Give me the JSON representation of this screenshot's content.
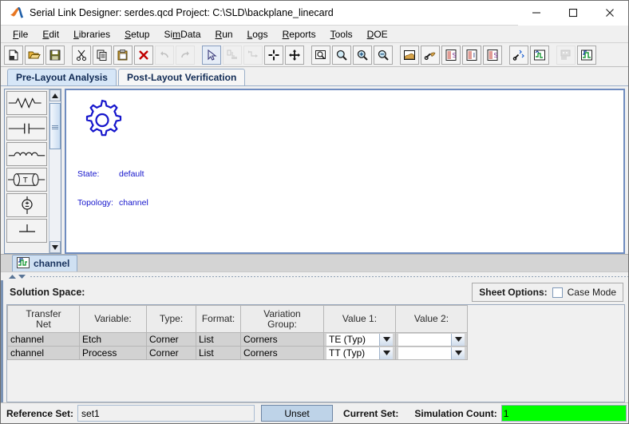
{
  "window": {
    "title": "Serial Link Designer: serdes.qcd Project: C:\\SLD\\backplane_linecard",
    "logo_icon": "matlab-membrane-icon",
    "minimize_label": "minimize-icon",
    "maximize_label": "maximize-icon",
    "close_label": "close-icon"
  },
  "menu": {
    "items": [
      {
        "label": "File",
        "mnemonic": "F"
      },
      {
        "label": "Edit",
        "mnemonic": "E"
      },
      {
        "label": "Libraries",
        "mnemonic": "L"
      },
      {
        "label": "Setup",
        "mnemonic": "S"
      },
      {
        "label": "SimData",
        "mnemonic": "m"
      },
      {
        "label": "Run",
        "mnemonic": "R"
      },
      {
        "label": "Logs",
        "mnemonic": "L"
      },
      {
        "label": "Reports",
        "mnemonic": "R"
      },
      {
        "label": "Tools",
        "mnemonic": "T"
      },
      {
        "label": "DOE",
        "mnemonic": "D"
      }
    ]
  },
  "toolbar": {
    "buttons": [
      {
        "name": "new-icon",
        "enabled": true
      },
      {
        "name": "open-folder-icon",
        "enabled": true
      },
      {
        "name": "save-disk-icon",
        "enabled": true
      },
      {
        "name": "cut-scissors-icon",
        "enabled": true
      },
      {
        "name": "copy-icon",
        "enabled": true
      },
      {
        "name": "paste-clipboard-icon",
        "enabled": true
      },
      {
        "name": "delete-x-icon",
        "enabled": true
      },
      {
        "name": "undo-icon",
        "enabled": false
      },
      {
        "name": "redo-icon",
        "enabled": false
      },
      {
        "name": "select-arrow-icon",
        "enabled": true
      },
      {
        "name": "place-part-icon",
        "enabled": false
      },
      {
        "name": "route-icon",
        "enabled": false
      },
      {
        "name": "crosshair-icon",
        "enabled": true
      },
      {
        "name": "pan-move-icon",
        "enabled": true
      },
      {
        "name": "zoom-fit-icon",
        "enabled": true
      },
      {
        "name": "zoom-icon",
        "enabled": true
      },
      {
        "name": "zoom-in-icon",
        "enabled": true
      },
      {
        "name": "zoom-out-icon",
        "enabled": true
      },
      {
        "name": "stackup-icon",
        "enabled": true
      },
      {
        "name": "stackup-edit-icon",
        "enabled": true
      },
      {
        "name": "sheet-s-icon",
        "enabled": true
      },
      {
        "name": "sheet-i-icon",
        "enabled": true
      },
      {
        "name": "sheet-s2-icon",
        "enabled": true
      },
      {
        "name": "net-tools-icon",
        "enabled": true
      },
      {
        "name": "net-view-icon",
        "enabled": true
      },
      {
        "name": "report-icon",
        "enabled": false
      },
      {
        "name": "waveform-icon",
        "enabled": true
      }
    ]
  },
  "tabs": {
    "items": [
      {
        "label": "Pre-Layout Analysis",
        "selected": true
      },
      {
        "label": "Post-Layout Verification",
        "selected": false
      }
    ]
  },
  "palette": {
    "items": [
      {
        "name": "resistor-symbol"
      },
      {
        "name": "capacitor-symbol"
      },
      {
        "name": "inductor-symbol"
      },
      {
        "name": "transmission-line-symbol"
      },
      {
        "name": "voltage-source-symbol"
      },
      {
        "name": "ground-symbol"
      }
    ],
    "scroll_up_icon": "scroll-up-arrow",
    "scroll_down_icon": "scroll-down-arrow"
  },
  "canvas": {
    "node": {
      "icon": "gear-icon",
      "state_key": "State:",
      "state_value": "default",
      "topology_key": "Topology:",
      "topology_value": "channel",
      "color": "#1515cc"
    }
  },
  "sheet_tabs": {
    "items": [
      {
        "label": "channel",
        "icon": "waveform-sheet-icon",
        "selected": true
      }
    ]
  },
  "solution_space": {
    "title": "Solution Space:",
    "sheet_options_label": "Sheet Options:",
    "case_mode_label": "Case Mode",
    "case_mode_checked": false,
    "columns": [
      "Transfer\nNet",
      "Variable:",
      "Type:",
      "Format:",
      "Variation\nGroup:",
      "Value 1:",
      "Value 2:"
    ],
    "columns_flat": {
      "c0_line1": "Transfer",
      "c0_line2": "Net",
      "c1": "Variable:",
      "c2": "Type:",
      "c3": "Format:",
      "c4_line1": "Variation",
      "c4_line2": "Group:",
      "c5": "Value 1:",
      "c6": "Value 2:"
    },
    "rows": [
      {
        "transfer_net": "channel",
        "variable": "Etch",
        "type": "Corner",
        "format": "List",
        "variation_group": "Corners",
        "value1": "TE (Typ)",
        "value2": ""
      },
      {
        "transfer_net": "channel",
        "variable": "Process",
        "type": "Corner",
        "format": "List",
        "variation_group": "Corners",
        "value1": "TT (Typ)",
        "value2": ""
      }
    ]
  },
  "statusbar": {
    "reference_set_label": "Reference Set:",
    "reference_set_value": "set1",
    "unset_button": "Unset",
    "current_set_label": "Current Set:",
    "current_set_value": "",
    "simulation_count_label": "Simulation Count:",
    "simulation_count_value": "1",
    "simulation_count_color": "#00ff00"
  }
}
